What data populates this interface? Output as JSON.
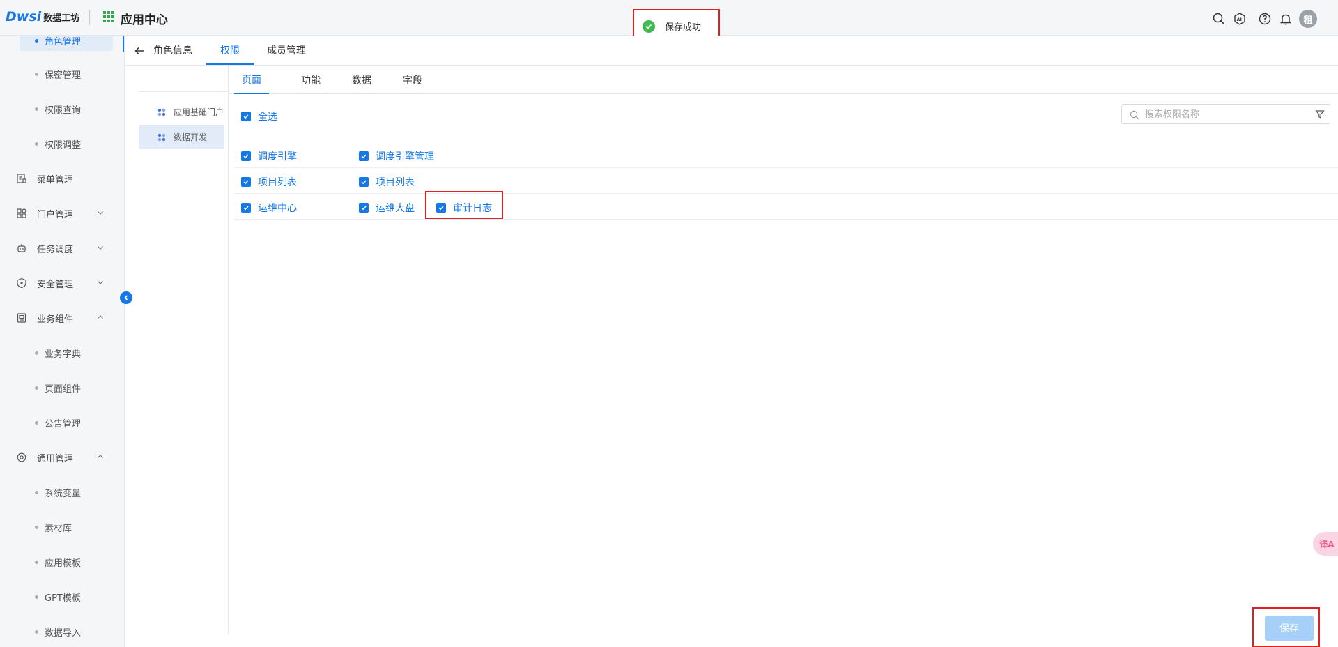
{
  "header": {
    "logo_mark": "Dwsi",
    "logo_text": "数据工坊",
    "app_title": "应用中心",
    "avatar_text": "租"
  },
  "toast": {
    "message": "保存成功"
  },
  "sidebar": {
    "items": [
      {
        "label": "角色管理",
        "kind": "sub",
        "active": true
      },
      {
        "label": "保密管理",
        "kind": "sub"
      },
      {
        "label": "权限查询",
        "kind": "sub"
      },
      {
        "label": "权限调整",
        "kind": "sub"
      },
      {
        "label": "菜单管理",
        "kind": "group",
        "icon": "menu-icon"
      },
      {
        "label": "门户管理",
        "kind": "group",
        "icon": "portal-icon",
        "chevron": "down"
      },
      {
        "label": "任务调度",
        "kind": "group",
        "icon": "robot-icon",
        "chevron": "down"
      },
      {
        "label": "安全管理",
        "kind": "group",
        "icon": "shield-icon",
        "chevron": "down"
      },
      {
        "label": "业务组件",
        "kind": "group",
        "icon": "component-icon",
        "chevron": "up"
      },
      {
        "label": "业务字典",
        "kind": "sub"
      },
      {
        "label": "页面组件",
        "kind": "sub"
      },
      {
        "label": "公告管理",
        "kind": "sub"
      },
      {
        "label": "通用管理",
        "kind": "group",
        "icon": "settings-icon",
        "chevron": "up"
      },
      {
        "label": "系统变量",
        "kind": "sub"
      },
      {
        "label": "素材库",
        "kind": "sub"
      },
      {
        "label": "应用模板",
        "kind": "sub"
      },
      {
        "label": "GPT模板",
        "kind": "sub"
      },
      {
        "label": "数据导入",
        "kind": "sub"
      }
    ]
  },
  "tabs": {
    "main": [
      "角色信息",
      "权限",
      "成员管理"
    ],
    "sub": [
      "页面",
      "功能",
      "数据",
      "字段"
    ]
  },
  "left_nav": [
    "应用基础门户",
    "数据开发"
  ],
  "permissions": {
    "select_all": "全选",
    "search_placeholder": "搜索权限名称",
    "rows": [
      [
        "调度引擎",
        "调度引擎管理"
      ],
      [
        "项目列表",
        "项目列表"
      ],
      [
        "运维中心",
        "运维大盘",
        "审计日志"
      ]
    ]
  },
  "footer": {
    "save_label": "保存"
  },
  "fab": {
    "translate_label": "译A"
  },
  "colors": {
    "accent": "#1677e6",
    "success": "#3fb950",
    "highlight": "#e02020"
  }
}
